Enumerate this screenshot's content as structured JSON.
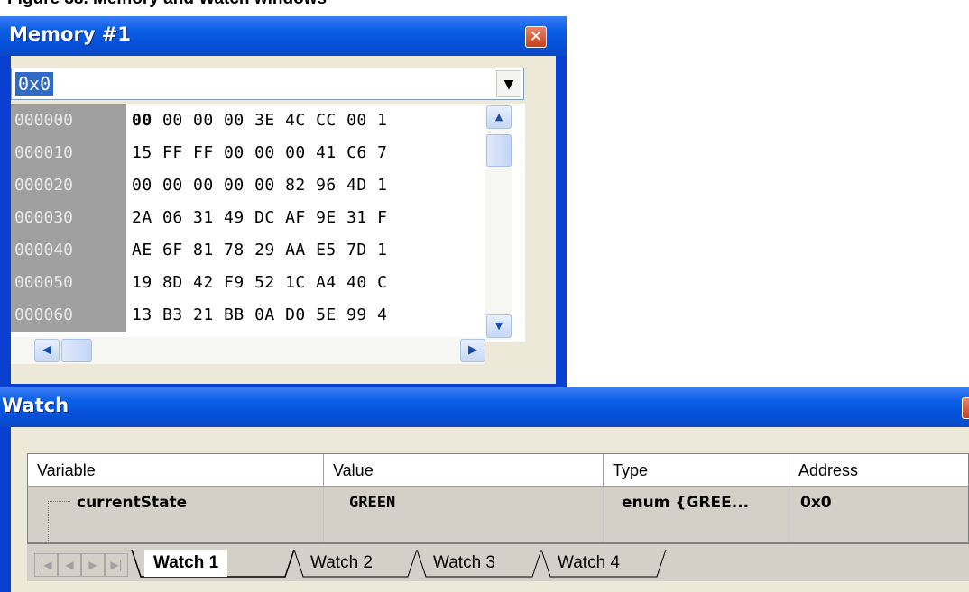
{
  "caption": "Figure 38. Memory and Watch windows",
  "memory_window": {
    "title": "Memory #1",
    "close_glyph": "✕",
    "address_value": "0x0",
    "dropdown_glyph": "▼",
    "rows": [
      {
        "addr": "000000",
        "first": "00",
        "rest": "00 00 00 3E 4C CC 00 1"
      },
      {
        "addr": "000010",
        "first": "15",
        "rest": "FF FF 00 00 00 41 C6 7"
      },
      {
        "addr": "000020",
        "first": "00",
        "rest": "00 00 00 00 82 96 4D 1"
      },
      {
        "addr": "000030",
        "first": "2A",
        "rest": "06 31 49 DC AF 9E 31 F"
      },
      {
        "addr": "000040",
        "first": "AE",
        "rest": "6F 81 78 29 AA E5 7D 1"
      },
      {
        "addr": "000050",
        "first": "19",
        "rest": "8D 42 F9 52 1C A4 40 C"
      },
      {
        "addr": "000060",
        "first": "13",
        "rest": "B3 21 BB 0A D0 5E 99 4"
      }
    ],
    "scroll_up": "▲",
    "scroll_down": "▼",
    "scroll_left": "◀",
    "scroll_right": "▶"
  },
  "watch_window": {
    "title": "Watch",
    "columns": [
      "Variable",
      "Value",
      "Type",
      "Address"
    ],
    "rows": [
      {
        "variable": "currentState",
        "value": "GREEN",
        "type": "enum {GREE...",
        "address": "0x0"
      }
    ],
    "nav_glyphs": [
      "|◀",
      "◀",
      "▶",
      "▶|"
    ],
    "tabs": [
      {
        "label": "Watch 1",
        "active": true
      },
      {
        "label": "Watch 2",
        "active": false
      },
      {
        "label": "Watch 3",
        "active": false
      },
      {
        "label": "Watch 4",
        "active": false
      }
    ]
  }
}
